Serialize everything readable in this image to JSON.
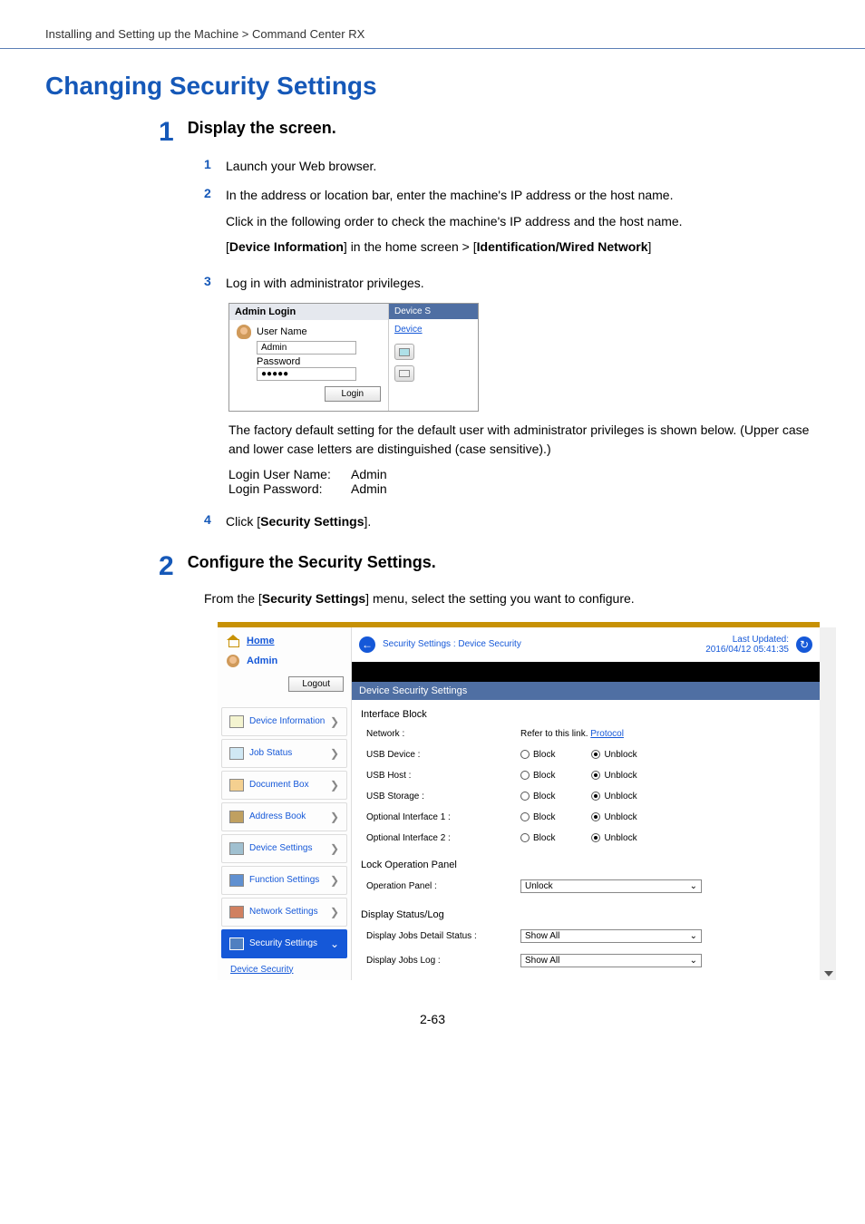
{
  "header": {
    "breadcrumb": "Installing and Setting up the Machine > Command Center RX"
  },
  "title": "Changing Security Settings",
  "steps": [
    {
      "heading": "Display the screen.",
      "subs": [
        {
          "text": "Launch your Web browser."
        },
        {
          "text": "In the address or location bar, enter the machine's IP address or the host name.",
          "p2": "Click in the following order to check the machine's IP address and the host name.",
          "p3_before": "[",
          "p3_b1": "Device Information",
          "p3_mid": "] in the home screen > [",
          "p3_b2": "Identification/Wired Network",
          "p3_after": "]"
        },
        {
          "text": "Log in with administrator privileges."
        },
        {
          "text_before": "Click [",
          "text_bold": "Security Settings",
          "text_after": "]."
        }
      ]
    },
    {
      "heading": "Configure the Security Settings.",
      "body_before": "From the [",
      "body_bold": "Security Settings",
      "body_after": "] menu, select the setting you want to configure."
    }
  ],
  "login_panel": {
    "title": "Admin Login",
    "user_label": "User Name",
    "user_value": "Admin",
    "pass_label": "Password",
    "pass_value": "●●●●●",
    "login_btn": "Login",
    "right_head": "Device S",
    "right_link": "Device"
  },
  "factory_text": "The factory default setting for the default user with administrator privileges is shown below. (Upper case and lower case letters are distinguished (case sensitive).)",
  "creds": {
    "user_label": "Login User Name:",
    "user_value": "Admin",
    "pass_label": "Login Password:",
    "pass_value": "Admin"
  },
  "webui": {
    "home": "Home",
    "admin": "Admin",
    "logout": "Logout",
    "crumb": "Security Settings : Device Security",
    "last_label": "Last Updated:",
    "last_value": "2016/04/12 05:41:35",
    "section_title": "Device Security Settings",
    "sidebar": [
      "Device Information",
      "Job Status",
      "Document Box",
      "Address Book",
      "Device Settings",
      "Function Settings",
      "Network Settings",
      "Security Settings"
    ],
    "device_security_link": "Device Security",
    "groups": {
      "interface_block": {
        "title": "Interface Block",
        "network_label": "Network :",
        "network_text": "Refer to this link.",
        "network_link": "Protocol",
        "rows": [
          "USB Device :",
          "USB Host :",
          "USB Storage :",
          "Optional Interface 1 :",
          "Optional Interface 2 :"
        ],
        "block": "Block",
        "unblock": "Unblock"
      },
      "lock_panel": {
        "title": "Lock Operation Panel",
        "label": "Operation Panel :",
        "value": "Unlock"
      },
      "display": {
        "title": "Display Status/Log",
        "rows": [
          {
            "label": "Display Jobs Detail Status :",
            "value": "Show All"
          },
          {
            "label": "Display Jobs Log :",
            "value": "Show All"
          }
        ]
      }
    }
  },
  "footer": "2-63"
}
